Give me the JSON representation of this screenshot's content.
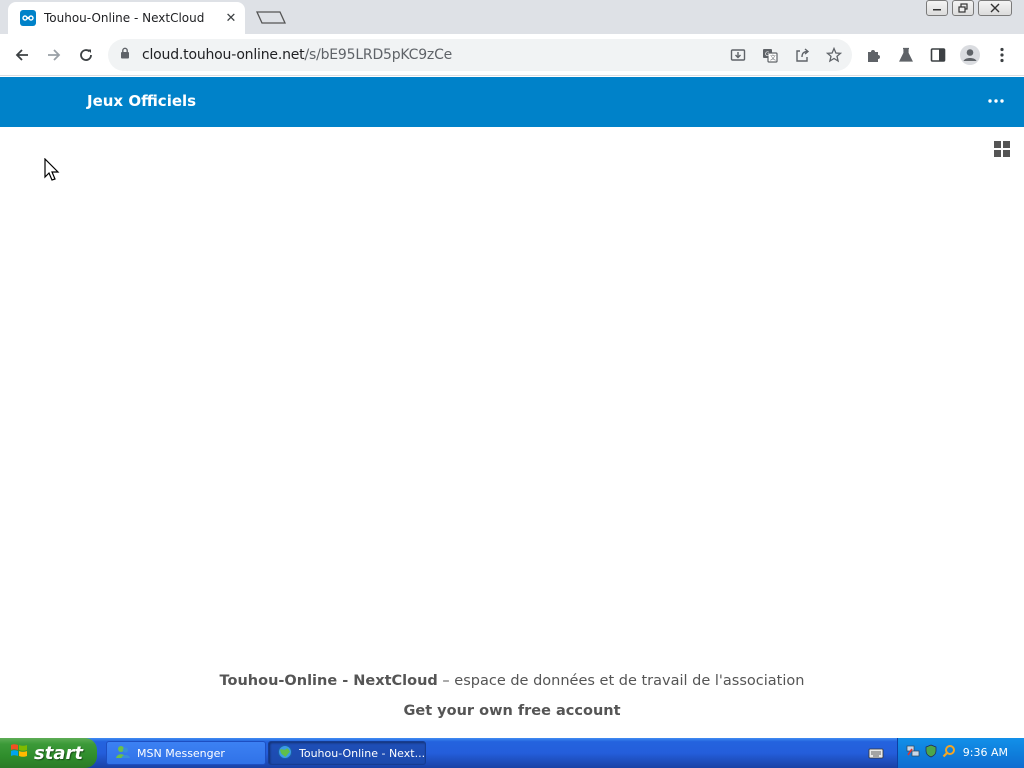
{
  "browser": {
    "tab": {
      "title": "Touhou-Online - NextCloud",
      "close": "✕"
    },
    "url": {
      "host": "cloud.touhou-online.net",
      "path": "/s/bE95LRD5pKC9zCe"
    }
  },
  "page": {
    "header_title": "Jeux Officiels",
    "footer": {
      "brand": "Touhou-Online - NextCloud",
      "tagline": " – espace de données et de travail de l'association",
      "signup": "Get your own free account"
    }
  },
  "taskbar": {
    "start_label": "start",
    "tasks": [
      {
        "label": "MSN Messenger"
      },
      {
        "label": "Touhou-Online - Next..."
      }
    ],
    "clock": "9:36 AM"
  },
  "colors": {
    "nextcloud_blue": "#0082c9",
    "chrome_tabstrip": "#dee1e6",
    "xp_taskbar": "#245edb",
    "xp_start": "#3c9a39"
  }
}
